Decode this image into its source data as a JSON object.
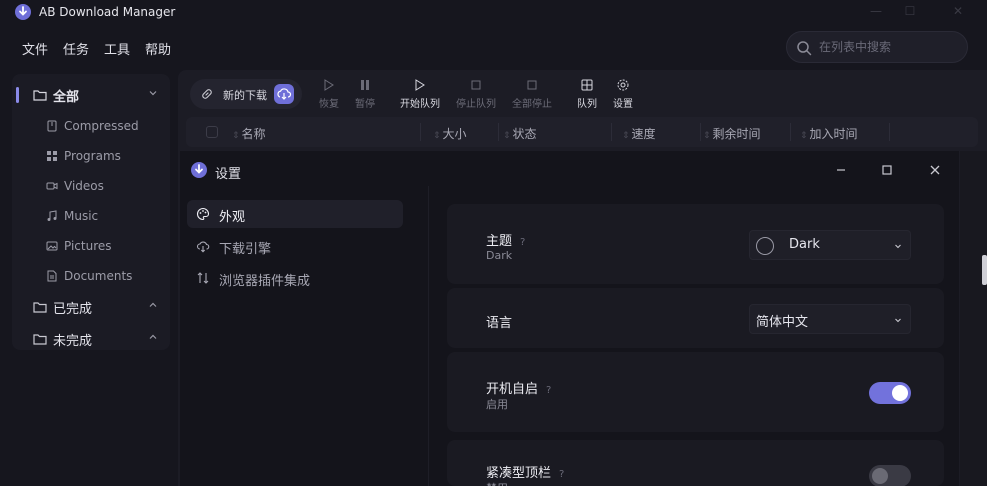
{
  "app": {
    "title": "AB Download Manager",
    "accent": "#7a7ae0"
  },
  "menu": [
    "文件",
    "任务",
    "工具",
    "帮助"
  ],
  "search": {
    "placeholder": "在列表中搜索",
    "icon": "search-icon"
  },
  "sidebar": {
    "all": {
      "label": "全部",
      "icon": "folder-icon"
    },
    "items": [
      {
        "label": "Compressed",
        "icon": "archive-icon"
      },
      {
        "label": "Programs",
        "icon": "grid-icon"
      },
      {
        "label": "Videos",
        "icon": "video-icon"
      },
      {
        "label": "Music",
        "icon": "music-icon"
      },
      {
        "label": "Pictures",
        "icon": "image-icon"
      },
      {
        "label": "Documents",
        "icon": "document-icon"
      }
    ],
    "finished": {
      "label": "已完成"
    },
    "unfinished": {
      "label": "未完成"
    }
  },
  "toolbar": {
    "new_download": "新的下载",
    "resume": "恢复",
    "pause": "暂停",
    "start_queue": "开始队列",
    "stop_queue": "停止队列",
    "stop_all": "全部停止",
    "queues": "队列",
    "settings": "设置"
  },
  "table": {
    "columns": [
      "名称",
      "大小",
      "状态",
      "速度",
      "剩余时间",
      "加入时间"
    ]
  },
  "settings_dialog": {
    "title": "设置",
    "nav": [
      {
        "label": "外观",
        "icon": "palette-icon",
        "active": true
      },
      {
        "label": "下载引擎",
        "icon": "cloud-download-icon",
        "active": false
      },
      {
        "label": "浏览器插件集成",
        "icon": "sort-arrows-icon",
        "active": false
      }
    ],
    "options": {
      "theme": {
        "title": "主题",
        "help": "?",
        "value": "Dark",
        "selected": "Dark"
      },
      "language": {
        "title": "语言",
        "selected": "简体中文"
      },
      "autostart": {
        "title": "开机自启",
        "help": "?",
        "value": "启用",
        "enabled": true
      },
      "compact": {
        "title": "紧凑型顶栏",
        "help": "?",
        "value": "禁用",
        "enabled": false
      }
    },
    "colors": {
      "toggle_on": "#7272dc",
      "toggle_off": "#3a3a44"
    }
  }
}
